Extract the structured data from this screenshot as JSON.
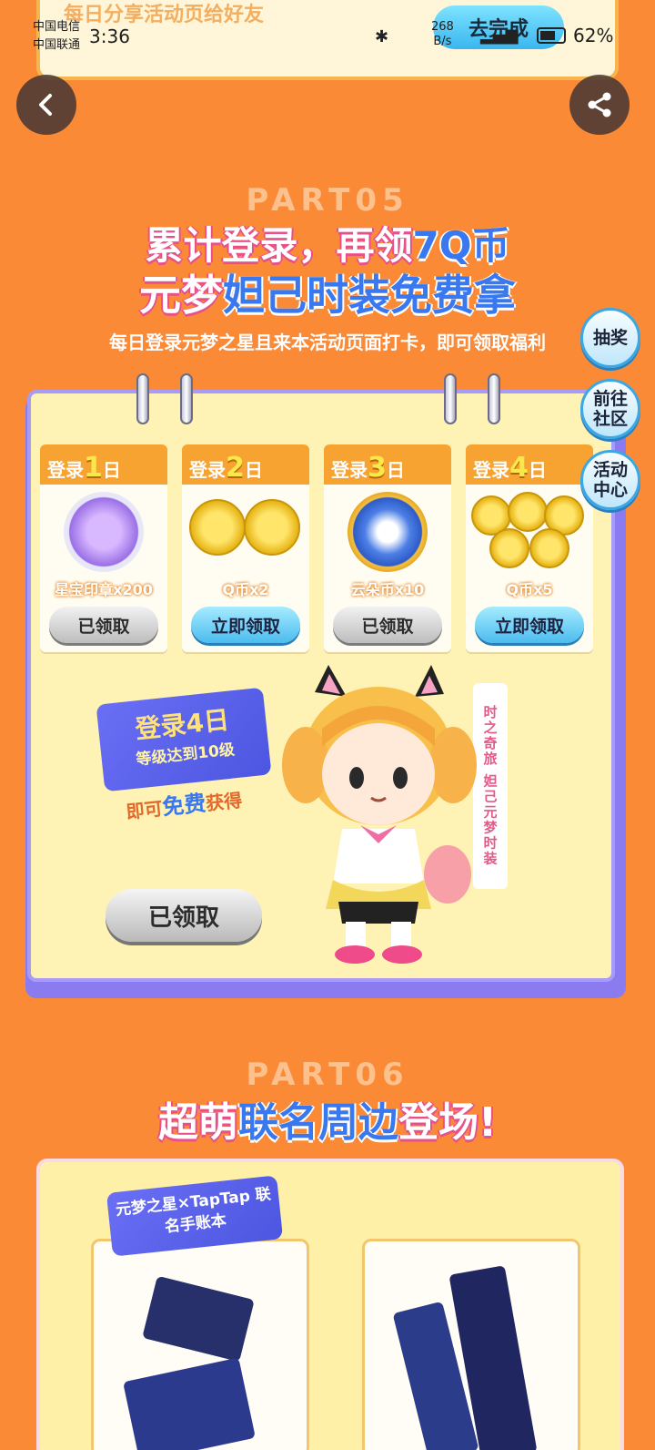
{
  "status_bar": {
    "carrier1": "中国电信",
    "carrier2": "中国联通",
    "time": "3:36",
    "net_speed_value": "268",
    "net_speed_unit": "B/s",
    "battery": "62%"
  },
  "top_banner": {
    "text": "每日分享活动页给好友",
    "button_label": "去完成"
  },
  "part05": {
    "part_label": "PART05",
    "title_line1_a": "累计登录，再领",
    "title_line1_b": "7Q币",
    "title_line2_a": "元梦",
    "title_line2_b": "妲己时装免费拿",
    "subtitle": "每日登录元梦之星且来本活动页面打卡，即可领取福利",
    "days": [
      {
        "prefix": "登录",
        "num": "1",
        "suffix": "日",
        "reward": "星宝印章x200",
        "button": "已领取",
        "state": "claimed"
      },
      {
        "prefix": "登录",
        "num": "2",
        "suffix": "日",
        "reward": "Q币x2",
        "button": "立即领取",
        "state": "available"
      },
      {
        "prefix": "登录",
        "num": "3",
        "suffix": "日",
        "reward": "云朵币x10",
        "button": "已领取",
        "state": "claimed"
      },
      {
        "prefix": "登录",
        "num": "4",
        "suffix": "日",
        "reward": "Q币x5",
        "button": "立即领取",
        "state": "available"
      }
    ],
    "bonus": {
      "title": "登录4日",
      "desc": "等级达到10级",
      "free_a": "即可",
      "free_b": "免费",
      "free_c": "获得",
      "button": "已领取",
      "costume_tag": "时之奇旅 妲己元梦时装"
    }
  },
  "side_buttons": {
    "lottery": "抽奖",
    "community": "前往社区",
    "activity": "活动中心"
  },
  "part06": {
    "part_label": "PART06",
    "title_a": "超萌",
    "title_b": "联名周边",
    "title_c": "登场!",
    "merch_tag": "元梦之星×TapTap 联名手账本"
  },
  "colors": {
    "background": "#fb8a37",
    "accent_blue": "#3a78f0",
    "title_pink": "#e8508a"
  }
}
